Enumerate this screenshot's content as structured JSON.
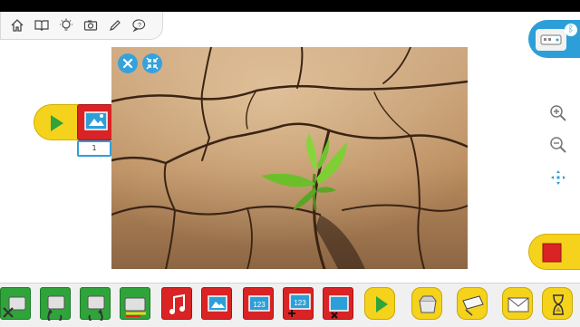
{
  "program": {
    "param_value": "1"
  },
  "icons": {
    "toolbar": [
      "home-icon",
      "book-icon",
      "lightbulb-icon",
      "camera-icon",
      "pencil-icon",
      "help-icon"
    ],
    "hub": "hub-device-icon",
    "right": [
      "zoom-in-icon",
      "zoom-out-icon",
      "fit-screen-icon"
    ],
    "palette": [
      "motor-off-icon",
      "motor-rotate-left-icon",
      "motor-rotate-right-icon",
      "motor-power-icon",
      "sound-icon",
      "display-image-icon",
      "display-number-icon",
      "display-add-number-icon",
      "display-clear-icon",
      "start-icon",
      "touch-input-icon",
      "tilt-input-icon",
      "message-icon",
      "wait-timer-icon"
    ]
  },
  "colors": {
    "accent": "#2d9fd8",
    "block_yellow": "#f5d21b",
    "block_red": "#d92325",
    "block_green": "#2fa43b"
  }
}
